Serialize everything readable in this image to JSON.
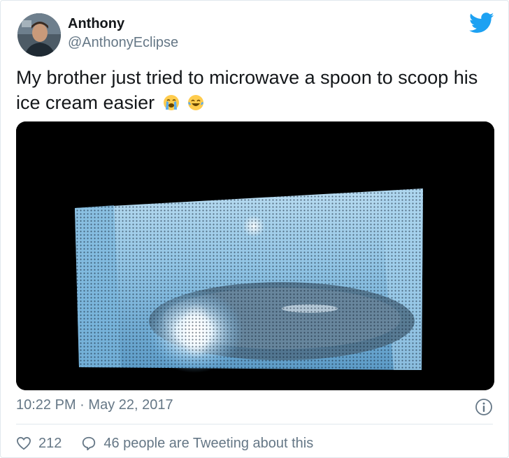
{
  "user": {
    "display_name": "Anthony",
    "handle": "@AnthonyEclipse",
    "avatar_icon": "profile-photo"
  },
  "tweet": {
    "text": "My brother just tried to microwave a spoon to scoop his ice cream easier",
    "emojis": [
      "loudly-crying-face-icon",
      "tears-of-joy-face-icon"
    ],
    "media_icon": "microwave-sparking-spoon-photo"
  },
  "meta": {
    "time": "10:22 PM",
    "separator": "·",
    "date": "May 22, 2017"
  },
  "actions": {
    "likes_count": "212",
    "reply_text": "46 people are Tweeting about this"
  },
  "colors": {
    "twitter_blue": "#1da1f2",
    "text_primary": "#14171a",
    "text_secondary": "#657786",
    "border": "#e1e8ed"
  }
}
